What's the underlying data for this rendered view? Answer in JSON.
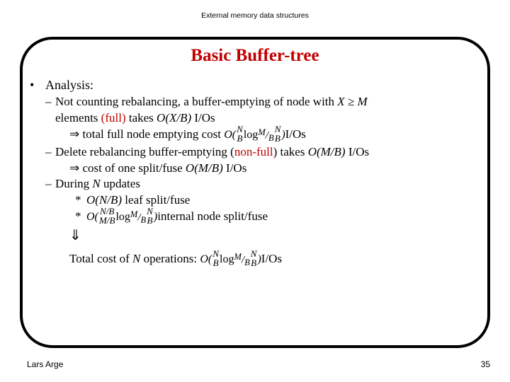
{
  "header": {
    "text": "External memory data structures"
  },
  "title": "Basic Buffer-tree",
  "footer": {
    "author": "Lars Arge",
    "page_number": "35"
  },
  "content": {
    "bullet1": {
      "marker": "•",
      "text": "Analysis:"
    },
    "sub1": {
      "marker": "–",
      "line1_a": "Not counting rebalancing, a buffer-emptying of node with ",
      "line1_math": "X ≥ M",
      "line2_a": "elements ",
      "line2_red": "(full)",
      "line2_b": " takes ",
      "line2_math": "O(X/B)",
      "line2_c": " I/Os"
    },
    "arrow1": {
      "marker": "⇒",
      "text_a": "total full node emptying cost ",
      "math": {
        "lead": "O(",
        "frac1_num": "N",
        "frac1_den": "B",
        "log": "log",
        "logsub_n": "M",
        "logsub_d": "B",
        "frac2_num": "N",
        "frac2_den": "B",
        "close": ")"
      },
      "text_b": "I/Os"
    },
    "sub2": {
      "marker": "–",
      "text_a": "Delete rebalancing buffer-emptying (",
      "red": "non-full",
      "text_b": ") takes ",
      "math": "O(M/B)",
      "text_c": " I/Os"
    },
    "arrow2": {
      "marker": "⇒",
      "text_a": "cost of one split/fuse ",
      "math": "O(M/B)",
      "text_b": " I/Os"
    },
    "sub3": {
      "marker": "–",
      "text_a": "During ",
      "math": "N",
      "text_b": " updates"
    },
    "star1": {
      "marker": "*",
      "math": "O(N/B)",
      "text": " leaf split/fuse"
    },
    "star2": {
      "marker": "*",
      "math": {
        "lead": "O(",
        "frac1_num": "N/B",
        "frac1_den": "M/B",
        "log": "log",
        "logsub_n": "M",
        "logsub_d": "B",
        "frac2_num": "N",
        "frac2_den": "B",
        "close": ")"
      },
      "text": "internal node split/fuse"
    },
    "downarrow": "⇓",
    "total": {
      "text_a": "Total cost of ",
      "math_n": "N",
      "text_b": " operations: ",
      "math": {
        "lead": "O(",
        "frac1_num": "N",
        "frac1_den": "B",
        "log": "log",
        "logsub_n": "M",
        "logsub_d": "B",
        "frac2_num": "N",
        "frac2_den": "B",
        "close": ")"
      },
      "text_c": "I/Os"
    }
  }
}
